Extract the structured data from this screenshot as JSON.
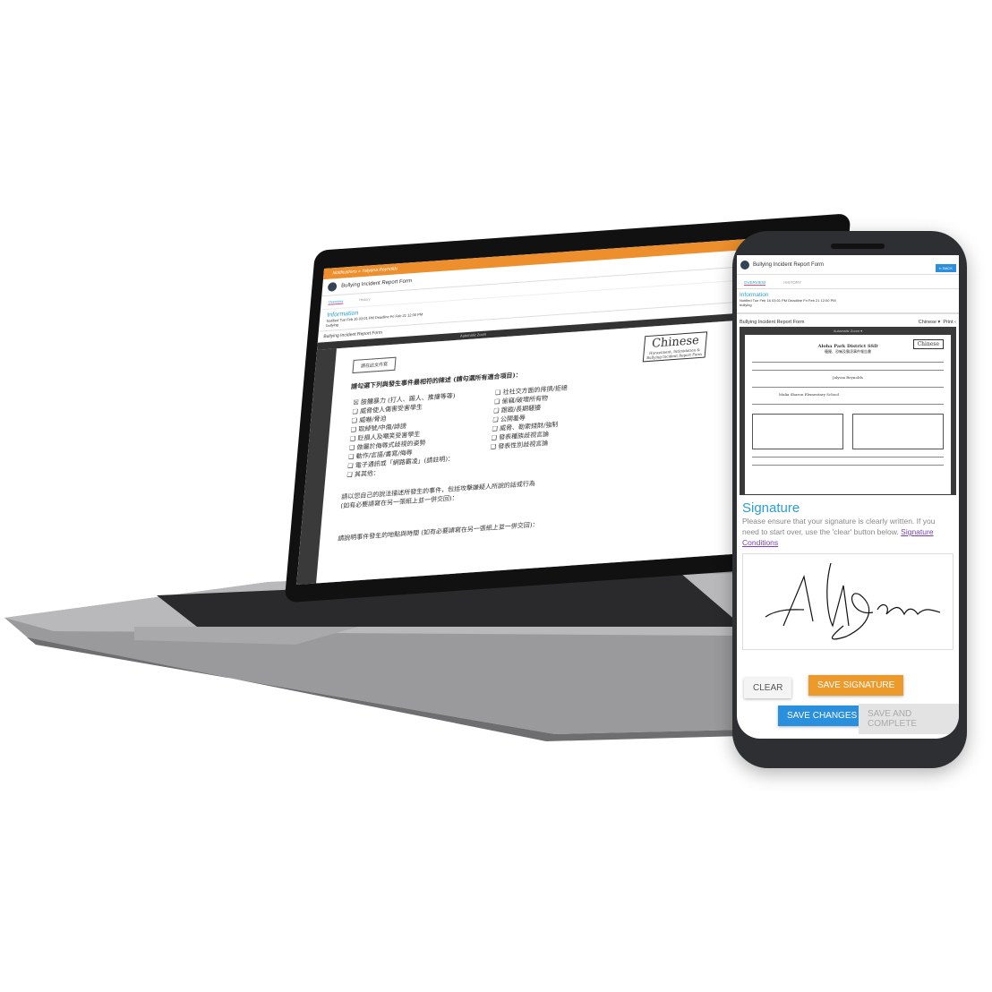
{
  "laptop": {
    "breadcrumb": "Notifications » Yatyana Reynolds",
    "title": "Bullying Incident Report Form",
    "tabs": [
      "Overview",
      "History"
    ],
    "info_title": "Information",
    "info_line": "Notified Tue Feb 16 03:01 PM  Deadline Fri Feb 21 12:00 PM",
    "info_sub": "bullying",
    "form_title": "Bullying Incident Report Form",
    "zoom": "Automatic Zoom",
    "doc": {
      "stamp": "請在此文件寫",
      "chinese": "Chinese",
      "chinese_sub1": "Harassment, Intimidation &",
      "chinese_sub2": "Bullying Incident Report Form",
      "question": "請勾選下列與發生事件最相符的陳述 (請勾選所有適合項目)：",
      "left_items": [
        "☒ 肢體暴力 (打人、踢人、推撞等等)",
        "❑ 威脅使人傷害受害學生",
        "❑ 威嚇/脅迫",
        "❑ 取綽號/中傷/誹謗",
        "❑ 貶損人及嘲笑受害學生",
        "❑ 做屬於侮辱式歧視的姿勢",
        "❑ 動作/言語/書寫/侮辱",
        "❑ 電子通訊或「網路霸凌」(請註明)：",
        "❑ 其其他："
      ],
      "right_items": [
        "❑ 社社交方面的排擠/拒絕",
        "❑ 偷竊/破壞所有物",
        "❑ 跟蹤/長期騷擾",
        "❑ 公開羞辱",
        "❑ 威脅、勒索錢財/強制",
        "❑ 發表種族歧視言論",
        "❑ 發表性別歧視言論"
      ],
      "describe": "請以您自己的說法描述所發生的事件，包括攻擊嫌疑人所說的話或行為",
      "describe_sub": "(如有必要請寫在另一張紙上並一併交回)：",
      "next": "請說明事件發生的地點與時間 (如有必要請寫在另一張紙上並一併交回)："
    }
  },
  "phone": {
    "title": "Bullying Incident Report Form",
    "back": "BACK",
    "tabs": [
      "OVERVIEW",
      "HISTORY"
    ],
    "info_title": "Information",
    "info_line": "Notified Tue Feb 16 03:01 PM  Deadline Fri Feb 21 12:00 PM",
    "info_sub": "bullying",
    "form_title": "Bullying Incident Report Form",
    "language": "Chinese",
    "print": "Print",
    "zoom": "Automatic Zoom",
    "doc": {
      "district": "Aloha Park District SSD",
      "subtitle": "騷擾、恐嚇及霸凌事件報告書",
      "chinese": "Chinese",
      "student": "Jalyssa Reynolds",
      "school": "Malia Sharon Elementary School"
    },
    "signature": {
      "title": "Signature",
      "text": "Please ensure that your signature is clearly written. If you need to start over, use the 'clear' button below.",
      "link": "Signature Conditions",
      "clear": "CLEAR",
      "save_signature": "SAVE SIGNATURE",
      "save_changes": "SAVE CHANGES",
      "save_complete": "SAVE AND COMPLETE"
    }
  },
  "colors": {
    "orange": "#ec8f2c",
    "blue": "#2a8fdc",
    "accent": "#2a9fd6",
    "pink": "#e04a7d"
  }
}
